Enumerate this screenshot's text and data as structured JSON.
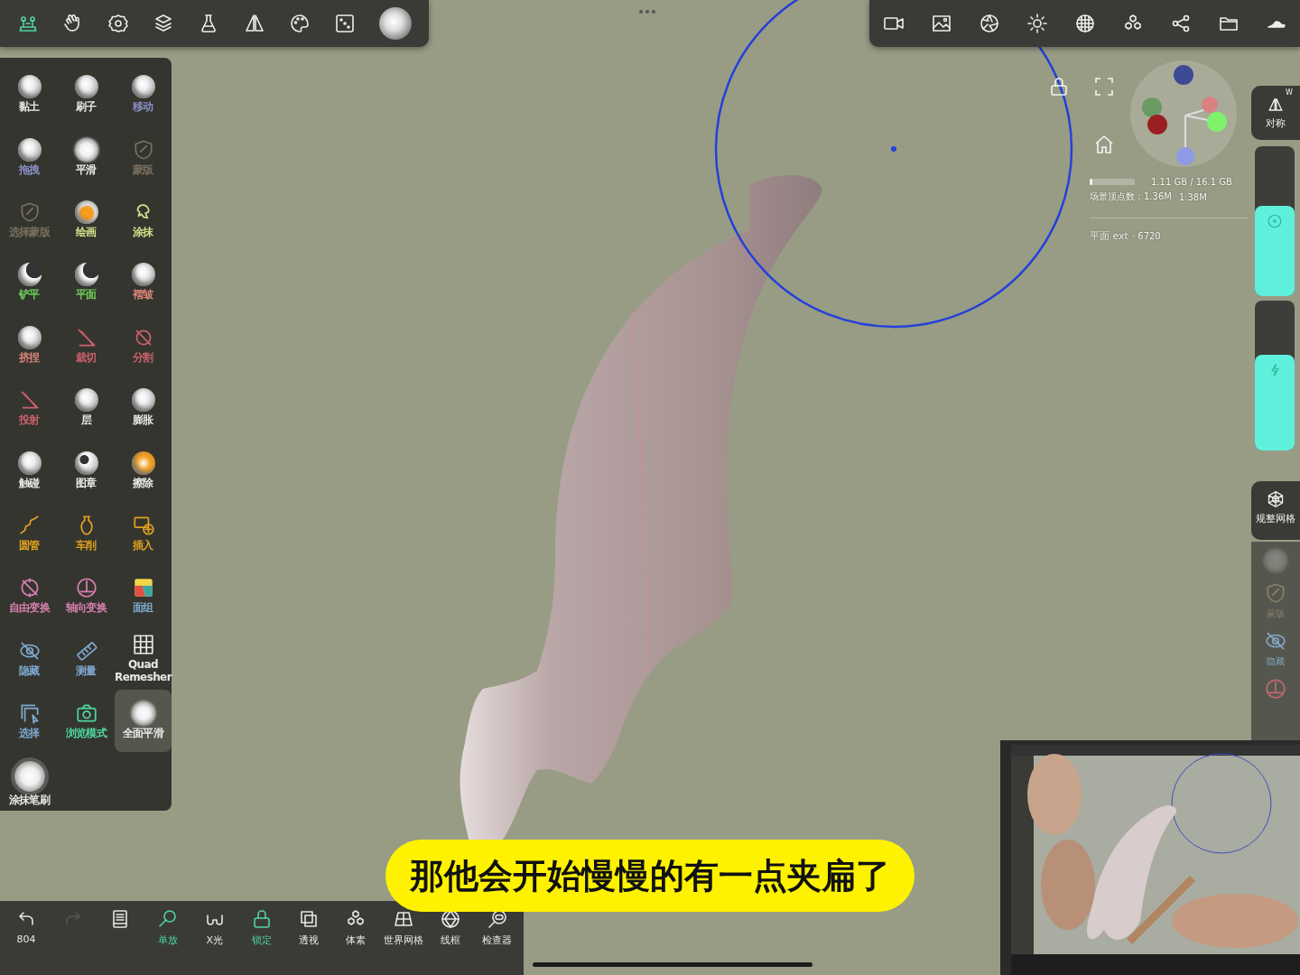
{
  "tools": [
    {
      "label": "黏土",
      "color": "#e8e8e8",
      "selected": false
    },
    {
      "label": "刷子",
      "color": "#e8e8e8",
      "selected": false
    },
    {
      "label": "移动",
      "color": "#8a8fc4",
      "selected": false
    },
    {
      "label": "拖拽",
      "color": "#8a8fc4",
      "selected": false
    },
    {
      "label": "平滑",
      "color": "#e8e8e8",
      "selected": false
    },
    {
      "label": "蒙版",
      "color": "#7a7060",
      "selected": false
    },
    {
      "label": "选择蒙版",
      "color": "#7a7060",
      "selected": false
    },
    {
      "label": "绘画",
      "color": "#d6e08a",
      "selected": false
    },
    {
      "label": "涂抹",
      "color": "#d6e08a",
      "selected": false
    },
    {
      "label": "铲平",
      "color": "#6fcf5a",
      "selected": false
    },
    {
      "label": "平面",
      "color": "#6fcf5a",
      "selected": false
    },
    {
      "label": "褶皱",
      "color": "#d9857a",
      "selected": false
    },
    {
      "label": "挤捏",
      "color": "#d9857a",
      "selected": false
    },
    {
      "label": "裁切",
      "color": "#c9606a",
      "selected": false
    },
    {
      "label": "分割",
      "color": "#c9606a",
      "selected": false
    },
    {
      "label": "投射",
      "color": "#c9606a",
      "selected": false
    },
    {
      "label": "层",
      "color": "#e8e8e8",
      "selected": false
    },
    {
      "label": "膨胀",
      "color": "#e8e8e8",
      "selected": false
    },
    {
      "label": "触碰",
      "color": "#e8e8e8",
      "selected": false
    },
    {
      "label": "图章",
      "color": "#e8e8e8",
      "selected": false
    },
    {
      "label": "擦除",
      "color": "#e8e8e8",
      "selected": false
    },
    {
      "label": "圆管",
      "color": "#e0a020",
      "selected": false
    },
    {
      "label": "车削",
      "color": "#e0a020",
      "selected": false
    },
    {
      "label": "插入",
      "color": "#e0a020",
      "selected": false
    },
    {
      "label": "自由变换",
      "color": "#d77fb0",
      "selected": false
    },
    {
      "label": "轴向变换",
      "color": "#d77fb0",
      "selected": false
    },
    {
      "label": "面组",
      "color": "#7fa8cf",
      "selected": false
    },
    {
      "label": "隐藏",
      "color": "#7fa8cf",
      "selected": false
    },
    {
      "label": "测量",
      "color": "#7fa8cf",
      "selected": false
    },
    {
      "label": "Quad Remesher",
      "color": "#e8e8e8",
      "selected": false
    },
    {
      "label": "选择",
      "color": "#7fa8cf",
      "selected": false
    },
    {
      "label": "浏览模式",
      "color": "#4fd6a0",
      "selected": false
    },
    {
      "label": "全面平滑",
      "color": "#e8e8e8",
      "selected": true
    },
    {
      "label": "涂抹笔刷",
      "color": "#e8e8e8",
      "selected": true
    }
  ],
  "stats": {
    "memory": "1.11 GB / 16.1 GB",
    "memory_level": {
      "level": 0.06
    },
    "vertices_label": "场景顶点数：1.36M",
    "vertices_total": "1.38M",
    "object": "平面 ext",
    "object_count": "· 6720"
  },
  "symmetry": {
    "label": "对称",
    "shortcut": "W"
  },
  "sliders": [
    {
      "level": 0.6
    },
    {
      "level": 0.64
    }
  ],
  "side_buttons": [
    {
      "label": "规整网格"
    },
    {
      "label": "蒙版"
    },
    {
      "label": "隐藏"
    }
  ],
  "bottom_bar": [
    {
      "label": "804",
      "on": false,
      "disabled": false
    },
    {
      "on": false,
      "disabled": true
    },
    {
      "on": false,
      "disabled": false
    },
    {
      "label": "单放",
      "on": true,
      "disabled": false
    },
    {
      "label": "X光",
      "on": false,
      "disabled": false
    },
    {
      "label": "锁定",
      "on": true,
      "disabled": false
    },
    {
      "label": "透视",
      "on": false,
      "disabled": false
    },
    {
      "label": "体素",
      "on": false,
      "disabled": false
    },
    {
      "label": "世界网格",
      "on": false,
      "disabled": false
    },
    {
      "label": "线框",
      "on": false,
      "disabled": false
    },
    {
      "label": "检查器",
      "on": false,
      "disabled": false
    }
  ],
  "subtitle": "那他会开始慢慢的有一点夹扁了"
}
